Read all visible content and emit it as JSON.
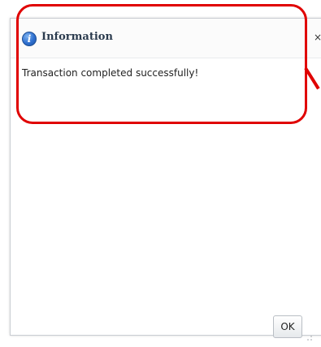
{
  "dialog": {
    "title": "Information",
    "close_glyph": "×",
    "message": "Transaction completed successfully!",
    "ok_label": "OK",
    "icon": "info-icon",
    "icon_glyph": "i"
  },
  "annotation": {
    "color": "#e00000"
  }
}
